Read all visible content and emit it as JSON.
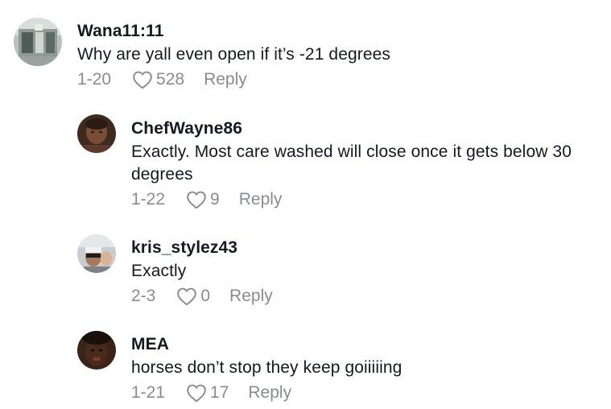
{
  "comments": [
    {
      "username": "Wana11:11",
      "text": "Why are yall even open if it’s -21 degrees",
      "date": "1-20",
      "likes": "528",
      "reply_label": "Reply",
      "avatar_icon": "storefront-photo"
    },
    {
      "username": "ChefWayne86",
      "text": "Exactly. Most care washed will close once it gets below 30 degrees",
      "date": "1-22",
      "likes": "9",
      "reply_label": "Reply",
      "avatar_icon": "person-photo"
    },
    {
      "username": "kris_stylez43",
      "text": "Exactly",
      "date": "2-3",
      "likes": "0",
      "reply_label": "Reply",
      "avatar_icon": "car-selfie-photo"
    },
    {
      "username": "MEA",
      "text": "horses don’t stop they keep goiiiiing",
      "date": "1-21",
      "likes": "17",
      "reply_label": "Reply",
      "avatar_icon": "person-photo"
    }
  ],
  "colors": {
    "username": "#161823",
    "text": "#161823",
    "meta": "#8a8b91"
  }
}
